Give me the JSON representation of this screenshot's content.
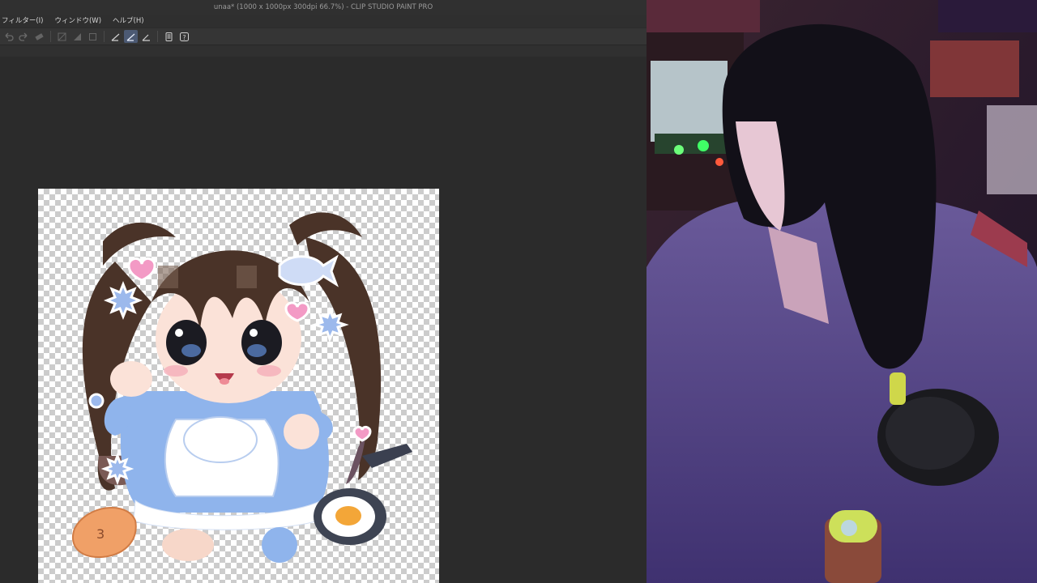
{
  "window": {
    "title": "unaa* (1000 x 1000px 300dpi 66.7%) - CLIP STUDIO PAINT PRO"
  },
  "menu": {
    "items": [
      {
        "label": "フィルター(I)"
      },
      {
        "label": "ウィンドウ(W)"
      },
      {
        "label": "ヘルプ(H)"
      }
    ]
  },
  "toolbar": {
    "buttons": [
      {
        "icon": "undo-icon",
        "enabled": false
      },
      {
        "icon": "redo-icon",
        "enabled": false
      },
      {
        "icon": "eraser-icon",
        "enabled": false
      },
      {
        "icon": "fill-icon",
        "enabled": false
      },
      {
        "icon": "transform-icon",
        "enabled": false
      },
      {
        "icon": "snap-icon",
        "enabled": false
      },
      {
        "icon": "ruler-snap-icon",
        "enabled": true
      },
      {
        "icon": "special-ruler-snap-icon",
        "enabled": true,
        "active": true
      },
      {
        "icon": "grid-snap-icon",
        "enabled": true
      },
      {
        "icon": "tablet-icon",
        "enabled": true
      },
      {
        "icon": "help-icon",
        "enabled": true
      }
    ]
  },
  "canvas": {
    "background": "transparent-checkerboard",
    "image": "chibi-maid-character-illustration"
  },
  "webcam": {
    "content": "streamer-webcam-feed"
  },
  "colors": {
    "ui_bg": "#2b2b2b",
    "accent_active": "#4c5a74",
    "dress_blue": "#8fb4ec",
    "hair_brown": "#4a3328",
    "cam_purple": "#5a4a86"
  }
}
